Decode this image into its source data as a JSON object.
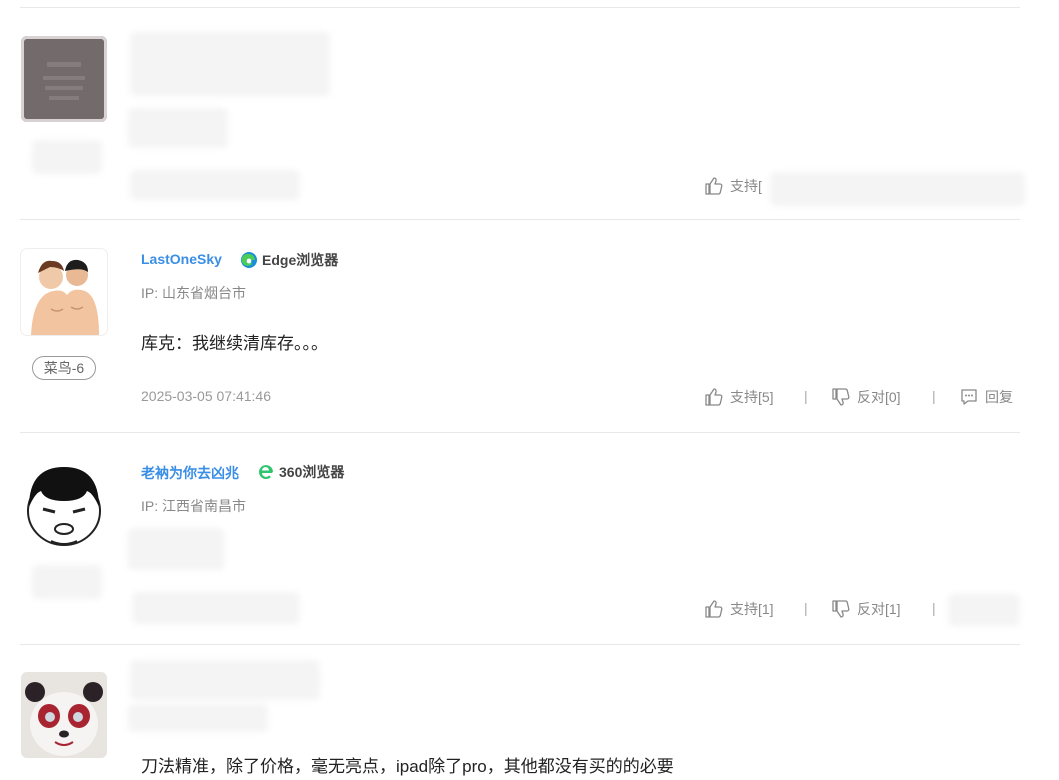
{
  "comments": [
    {
      "actions": {
        "support": "支持[",
        "reply": ""
      }
    },
    {
      "username": "LastOneSky",
      "browser": "Edge浏览器",
      "ip": "IP: 山东省烟台市",
      "badge": "菜鸟-6",
      "content": "库克：我继续清库存。。。",
      "time": "2025-03-05 07:41:46",
      "actions": {
        "support": "支持[5]",
        "oppose": "反对[0]",
        "reply": "回复"
      }
    },
    {
      "username": "老衲为你去凶兆",
      "browser": "360浏览器",
      "ip": "IP: 江西省南昌市",
      "actions": {
        "support": "支持[1]",
        "oppose": "反对[1]"
      }
    },
    {
      "content": "刀法精准，除了价格，毫无亮点，ipad除了pro，其他都没有买的的必要"
    }
  ],
  "separator": "|",
  "colors": {
    "username": "#3a8ee6",
    "divider": "#e8e8e8",
    "muted": "#888888"
  }
}
